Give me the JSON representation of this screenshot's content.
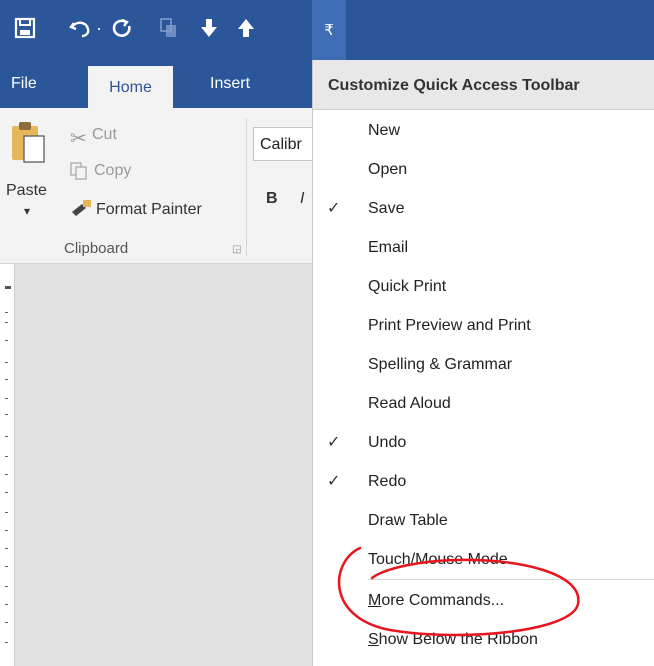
{
  "qat": {
    "icons": [
      "save-icon",
      "undo-icon",
      "redo-icon",
      "touch-mode-icon",
      "move-down-icon",
      "move-up-icon"
    ],
    "undo_dropdown": "·",
    "customize_glyph": "₹"
  },
  "tabs": [
    "File",
    "Home",
    "Insert"
  ],
  "ribbon": {
    "clipboard": {
      "paste": "Paste",
      "cut": "Cut",
      "copy": "Copy",
      "format_painter": "Format Painter",
      "group_label": "Clipboard"
    },
    "font": {
      "font_name": "Calibr",
      "bold": "B",
      "italic": "I"
    }
  },
  "menu": {
    "title": "Customize Quick Access Toolbar",
    "items": [
      {
        "label": "New",
        "checked": false
      },
      {
        "label": "Open",
        "checked": false
      },
      {
        "label": "Save",
        "checked": true
      },
      {
        "label": "Email",
        "checked": false
      },
      {
        "label": "Quick Print",
        "checked": false
      },
      {
        "label": "Print Preview and Print",
        "checked": false
      },
      {
        "label": "Spelling & Grammar",
        "checked": false
      },
      {
        "label": "Read Aloud",
        "checked": false
      },
      {
        "label": "Undo",
        "checked": true
      },
      {
        "label": "Redo",
        "checked": true
      },
      {
        "label": "Draw Table",
        "checked": false
      },
      {
        "label": "Touch/Mouse Mode",
        "checked": false
      }
    ],
    "more_commands_first": "M",
    "more_commands_rest": "ore Commands...",
    "show_below_first": "S",
    "show_below_rest": "how Below the Ribbon",
    "checkmark": "✓"
  },
  "annotation_color": "#e8141e"
}
